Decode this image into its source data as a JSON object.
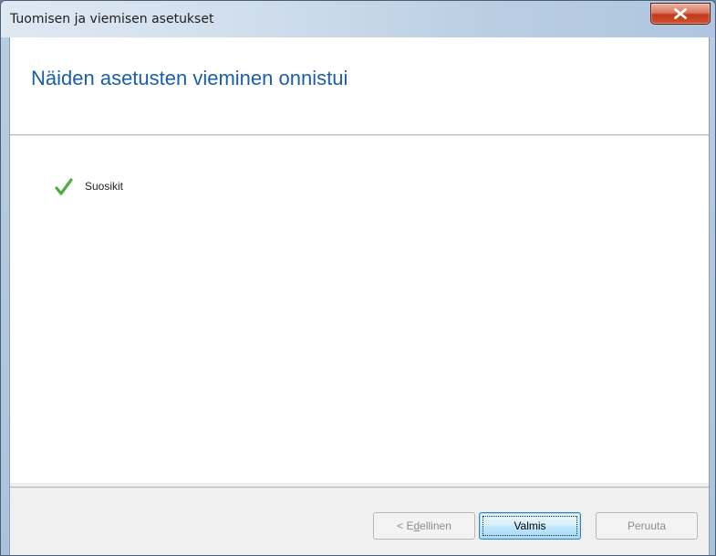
{
  "window": {
    "title": "Tuomisen ja viemisen asetukset",
    "close_label": "x"
  },
  "header": {
    "title": "Näiden asetusten vieminen onnistui"
  },
  "results": [
    {
      "label": "Suosikit",
      "status": "success",
      "icon": "check-icon"
    }
  ],
  "footer": {
    "back": {
      "prefix": "< E",
      "accel": "d",
      "suffix": "ellinen",
      "enabled": false
    },
    "finish": {
      "label": "Valmis",
      "enabled": true,
      "default": true
    },
    "cancel": {
      "label": "Peruuta",
      "enabled": false
    }
  },
  "colors": {
    "title_blue": "#1a5fa8",
    "check_green": "#4caf3a",
    "close_red": "#c2391c"
  }
}
